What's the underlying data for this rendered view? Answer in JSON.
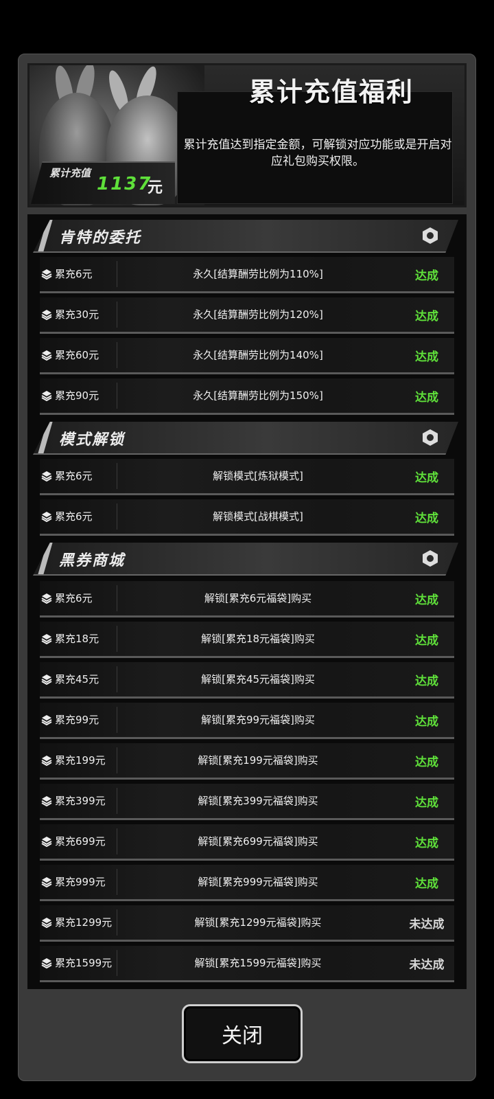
{
  "banner": {
    "title": "累计充值福利",
    "description": "累计充值达到指定金额，可解锁对应功能或是开启对应礼包购买权限。",
    "total_label": "累计充值",
    "total_value": "1137",
    "total_unit": "元"
  },
  "colors": {
    "achieved": "#5fe03a",
    "not_achieved": "#d8d8d8",
    "panel": "#3a3a3a"
  },
  "sections": [
    {
      "title": "肯特的委托",
      "icon": "hexagon-icon",
      "rows": [
        {
          "requirement": "累充6元",
          "reward": "永久[结算酬劳比例为110%]",
          "status": "达成",
          "achieved": true
        },
        {
          "requirement": "累充30元",
          "reward": "永久[结算酬劳比例为120%]",
          "status": "达成",
          "achieved": true
        },
        {
          "requirement": "累充60元",
          "reward": "永久[结算酬劳比例为140%]",
          "status": "达成",
          "achieved": true
        },
        {
          "requirement": "累充90元",
          "reward": "永久[结算酬劳比例为150%]",
          "status": "达成",
          "achieved": true
        }
      ]
    },
    {
      "title": "模式解锁",
      "icon": "hexagon-icon",
      "rows": [
        {
          "requirement": "累充6元",
          "reward": "解锁模式[炼狱模式]",
          "status": "达成",
          "achieved": true
        },
        {
          "requirement": "累充6元",
          "reward": "解锁模式[战棋模式]",
          "status": "达成",
          "achieved": true
        }
      ]
    },
    {
      "title": "黑券商城",
      "icon": "hexagon-icon",
      "rows": [
        {
          "requirement": "累充6元",
          "reward": "解锁[累充6元福袋]购买",
          "status": "达成",
          "achieved": true
        },
        {
          "requirement": "累充18元",
          "reward": "解锁[累充18元福袋]购买",
          "status": "达成",
          "achieved": true
        },
        {
          "requirement": "累充45元",
          "reward": "解锁[累充45元福袋]购买",
          "status": "达成",
          "achieved": true
        },
        {
          "requirement": "累充99元",
          "reward": "解锁[累充99元福袋]购买",
          "status": "达成",
          "achieved": true
        },
        {
          "requirement": "累充199元",
          "reward": "解锁[累充199元福袋]购买",
          "status": "达成",
          "achieved": true
        },
        {
          "requirement": "累充399元",
          "reward": "解锁[累充399元福袋]购买",
          "status": "达成",
          "achieved": true
        },
        {
          "requirement": "累充699元",
          "reward": "解锁[累充699元福袋]购买",
          "status": "达成",
          "achieved": true
        },
        {
          "requirement": "累充999元",
          "reward": "解锁[累充999元福袋]购买",
          "status": "达成",
          "achieved": true
        },
        {
          "requirement": "累充1299元",
          "reward": "解锁[累充1299元福袋]购买",
          "status": "未达成",
          "achieved": false
        },
        {
          "requirement": "累充1599元",
          "reward": "解锁[累充1599元福袋]购买",
          "status": "未达成",
          "achieved": false
        }
      ]
    }
  ],
  "footer": {
    "close_label": "关闭"
  }
}
